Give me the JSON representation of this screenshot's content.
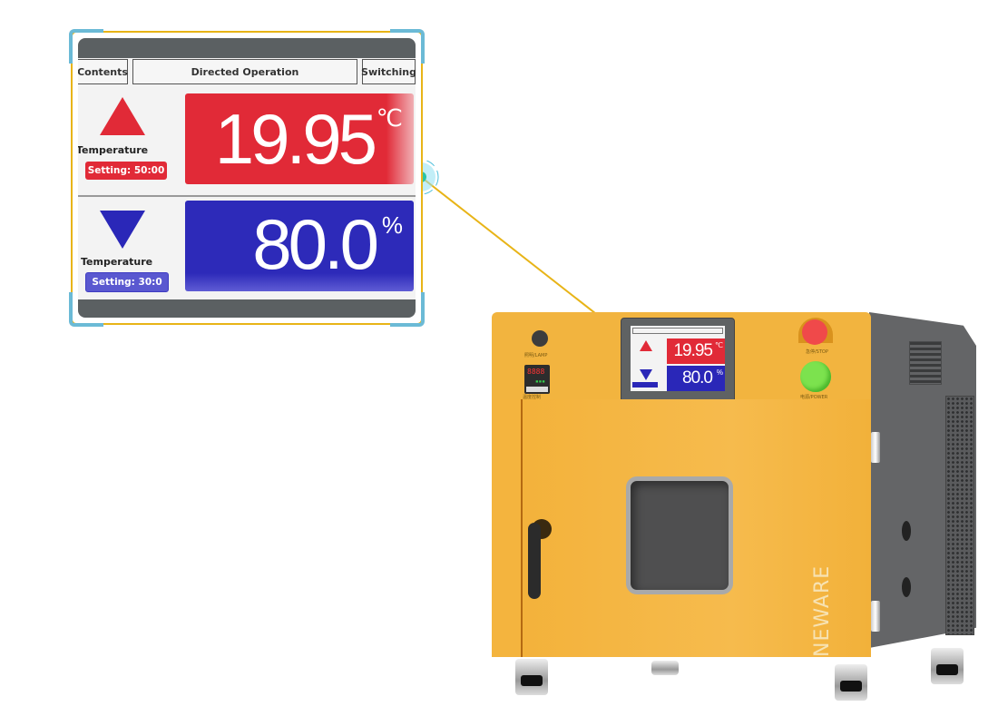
{
  "callout": {
    "tabs": [
      {
        "label": "Contents"
      },
      {
        "label": "Directed Operation"
      },
      {
        "label": "Switching"
      }
    ],
    "rows": [
      {
        "indicator": "triangle-up-icon",
        "label": "Temperature",
        "setting": "Setting:  50:00",
        "value": "19.95",
        "unit": "℃",
        "color": "#e12a37"
      },
      {
        "indicator": "triangle-down-icon",
        "label": "Temperature",
        "setting": "Setting:  30:0",
        "value": "80.0",
        "unit": "%",
        "color": "#2a27b8"
      }
    ]
  },
  "machine": {
    "brand": "NEWARE",
    "screen": {
      "temperature": "19.95",
      "temperature_unit": "℃",
      "humidity": "80.0",
      "humidity_unit": "%"
    },
    "controller_display": "8888",
    "controls": {
      "lamp_label": "照明/LAMP",
      "controller_label": "温度控制",
      "stop_label": "急停/STOP",
      "power_label": "电源/POWER"
    }
  },
  "colors": {
    "accent_red": "#e12a37",
    "accent_blue": "#2a27b8",
    "frame": "#e8b417",
    "corner": "#6bbad6",
    "machine_body": "#f4b43e"
  }
}
